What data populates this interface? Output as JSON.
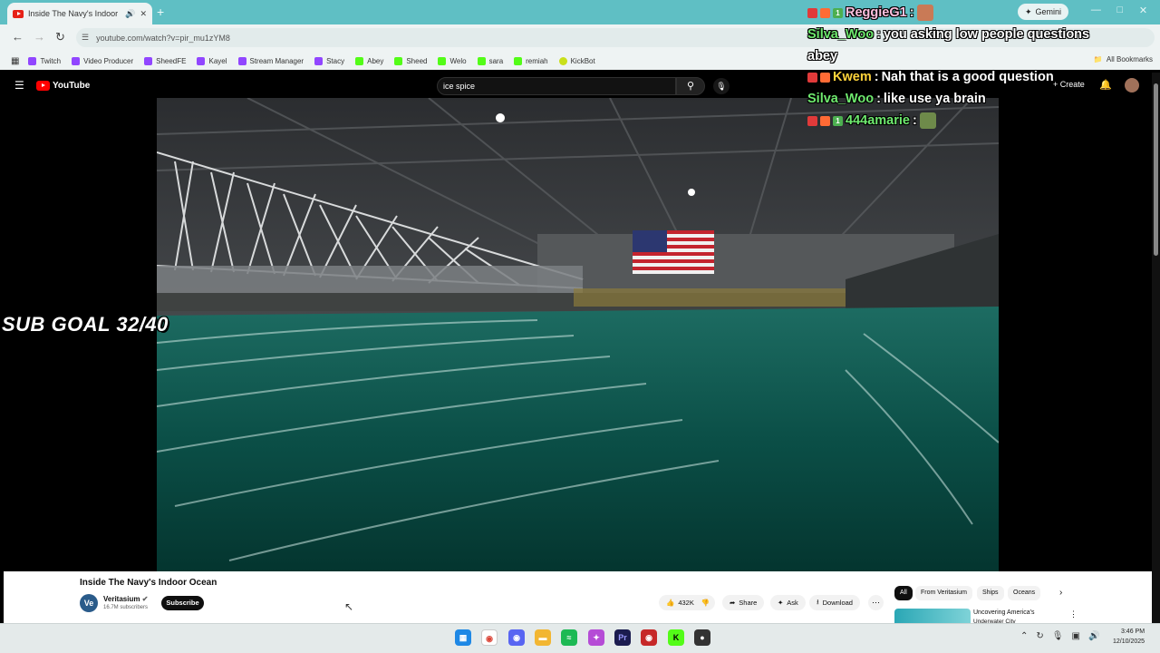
{
  "browser": {
    "tab_title": "Inside The Navy's Indoor O",
    "new_tab_label": "+",
    "gemini_label": "Gemini",
    "url": "youtube.com/watch?v=pir_mu1zYM8",
    "bookmarks": [
      {
        "label": "Twitch",
        "icon": "twitch"
      },
      {
        "label": "Video Producer",
        "icon": "twitch"
      },
      {
        "label": "SheedFE",
        "icon": "twitch"
      },
      {
        "label": "Kayel",
        "icon": "twitch"
      },
      {
        "label": "Stream Manager",
        "icon": "twitch"
      },
      {
        "label": "Stacy",
        "icon": "twitch"
      },
      {
        "label": "Abey",
        "icon": "kick"
      },
      {
        "label": "Sheed",
        "icon": "kick"
      },
      {
        "label": "Welo",
        "icon": "kick"
      },
      {
        "label": "sara",
        "icon": "kick"
      },
      {
        "label": "remiah",
        "icon": "kick"
      },
      {
        "label": "KickBot",
        "icon": "kickbot"
      }
    ],
    "all_bookmarks_label": "All Bookmarks"
  },
  "youtube": {
    "logo_text": "YouTube",
    "search_value": "ice spice",
    "create_label": "Create"
  },
  "overlay": {
    "sub_goal": "SUB GOAL 32/40",
    "chat": [
      {
        "user": "ReggieG1",
        "message": "",
        "color": "#ffc1e0",
        "badges": true,
        "emote": true
      },
      {
        "user": "Silva_Woo",
        "message": "you asking low people questions",
        "color": "#6ee96e",
        "badges": false
      },
      {
        "user": "",
        "message": "abey",
        "color": "#ffffff",
        "badges": false
      },
      {
        "user": "Kwem",
        "message": "Nah that is a good question",
        "color": "#ffd43b",
        "badges": true
      },
      {
        "user": "Silva_Woo",
        "message": "like use ya brain",
        "color": "#6ee96e",
        "badges": false
      },
      {
        "user": "444amarie",
        "message": "",
        "color": "#6ee96e",
        "badges": true,
        "emote": true
      }
    ]
  },
  "video": {
    "title": "Inside The Navy's Indoor Ocean",
    "channel": "Veritasium",
    "channel_initials": "Ve",
    "subscribers": "16.7M subscribers",
    "subscribe_label": "Subscribe",
    "likes": "432K",
    "share_label": "Share",
    "ask_label": "Ask",
    "download_label": "Download"
  },
  "related": {
    "chips": [
      "All",
      "From Veritasium",
      "Ships",
      "Oceans"
    ],
    "first_title": "Uncovering America's",
    "first_title_line2": "Underwater City"
  },
  "taskbar": {
    "time": "3:46 PM",
    "date": "12/10/2025"
  }
}
